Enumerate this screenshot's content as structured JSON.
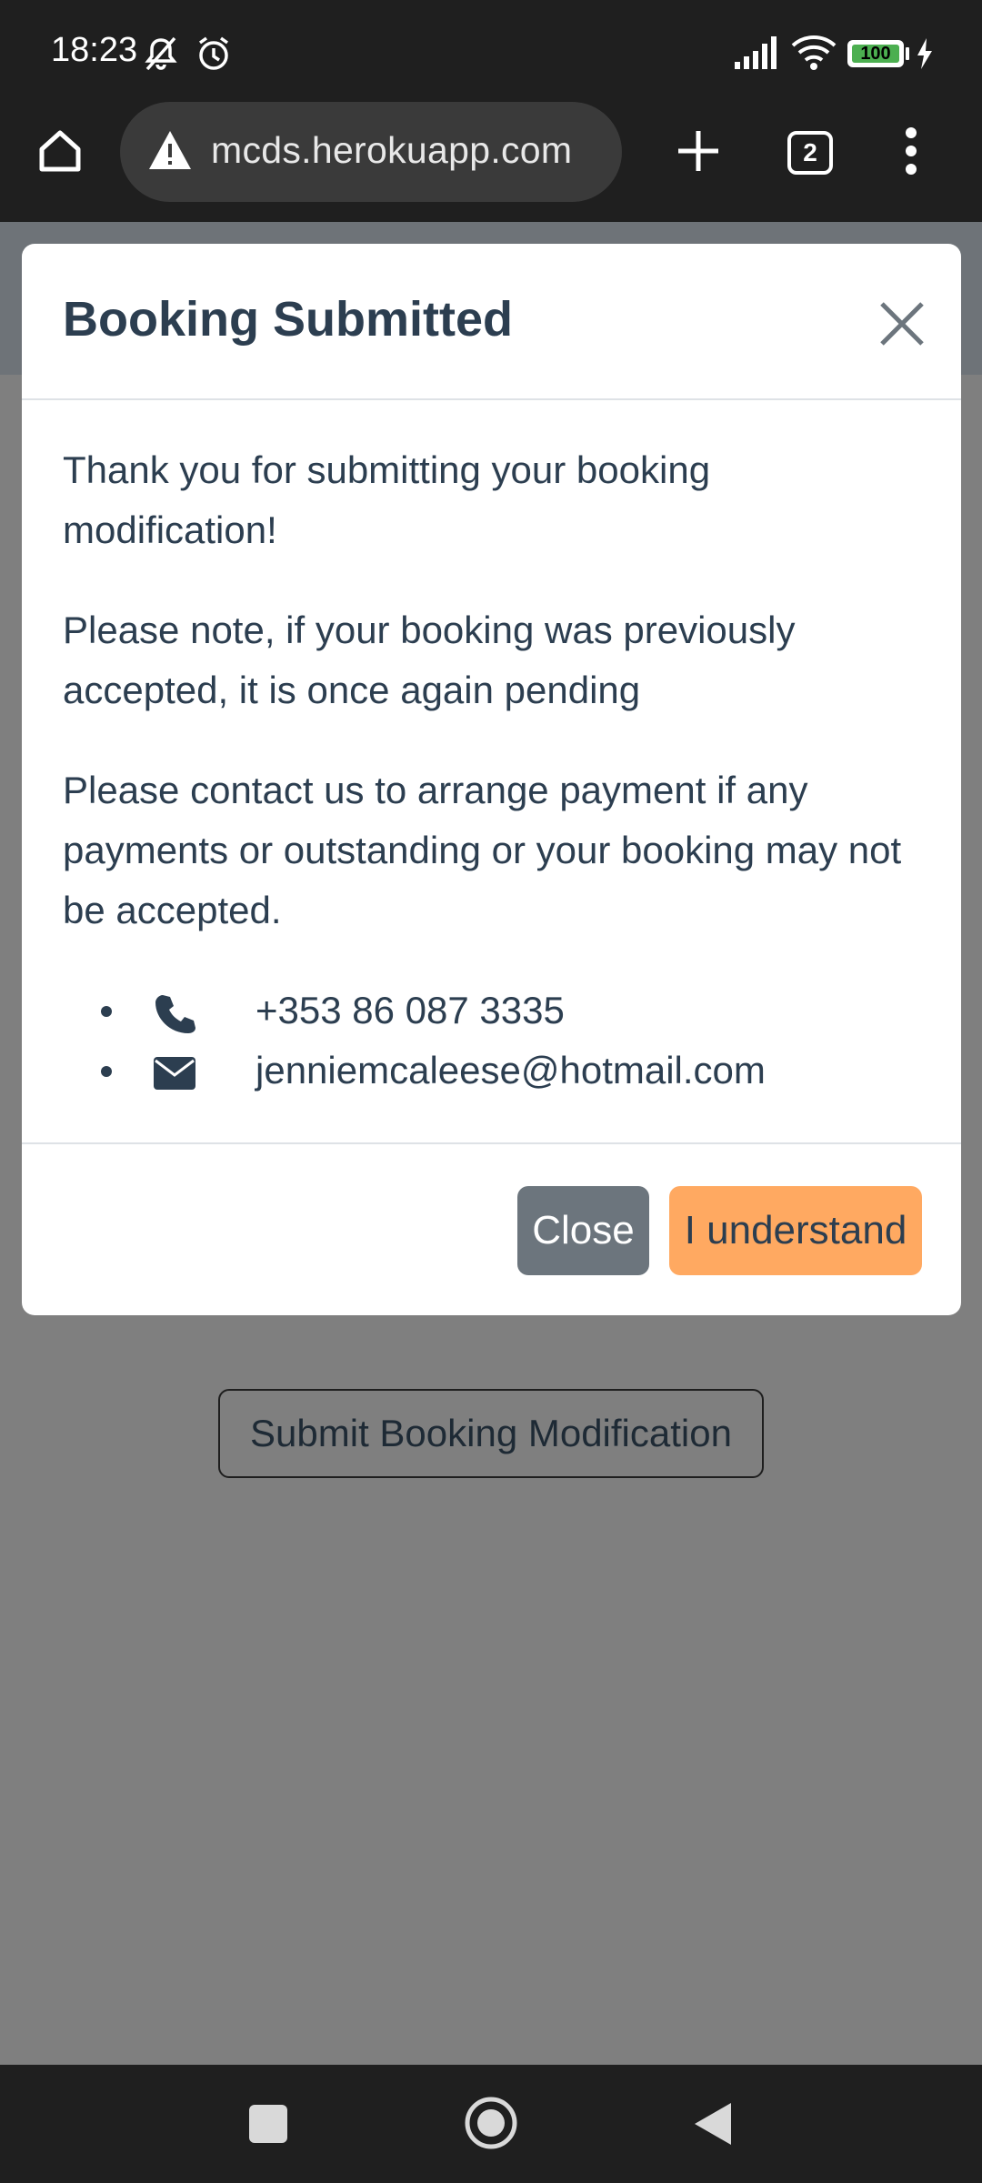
{
  "status_bar": {
    "time": "18:23",
    "battery": "100"
  },
  "browser": {
    "url": "mcds.herokuapp.com",
    "tab_count": "2"
  },
  "modal": {
    "title": "Booking Submitted",
    "paragraphs": [
      "Thank you for submitting your booking modification!",
      "Please note, if your booking was previously accepted, it is once again pending",
      "Please contact us to arrange payment if any payments or outstanding or your booking may not be accepted."
    ],
    "contacts": [
      {
        "icon": "phone-icon",
        "text": "+353 86 087 3335"
      },
      {
        "icon": "envelope-icon",
        "text": "jenniemcaleese@hotmail.com"
      }
    ],
    "close_label": "Close",
    "understand_label": "I understand"
  },
  "page": {
    "submit_label": "Submit Booking Modification"
  },
  "colors": {
    "overlay": "#7f7f7f",
    "accent_button": "#ffa961",
    "secondary_button": "#6c757d",
    "text": "#2c3e50"
  }
}
